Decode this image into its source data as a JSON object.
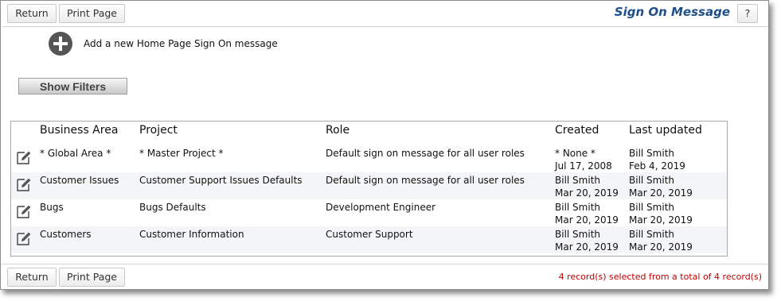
{
  "toolbar": {
    "return_label": "Return",
    "print_label": "Print Page",
    "help_label": "?"
  },
  "page_title": "Sign On Message",
  "add": {
    "icon": "plus-circle-icon",
    "label": "Add a new Home Page Sign On message"
  },
  "filters_label": "Show Filters",
  "table": {
    "headers": {
      "area": "Business Area",
      "project": "Project",
      "role": "Role",
      "created": "Created",
      "updated": "Last updated"
    },
    "rows": [
      {
        "area": "* Global Area *",
        "project": "* Master Project *",
        "role": "Default sign on message for all user roles",
        "created_by": "* None *",
        "created_on": "Jul 17, 2008",
        "updated_by": "Bill Smith",
        "updated_on": "Feb 4, 2019"
      },
      {
        "area": "Customer Issues",
        "project": "Customer Support Issues Defaults",
        "role": "Default sign on message for all user roles",
        "created_by": "Bill Smith",
        "created_on": "Mar 20, 2019",
        "updated_by": "Bill Smith",
        "updated_on": "Mar 20, 2019"
      },
      {
        "area": "Bugs",
        "project": "Bugs Defaults",
        "role": "Development Engineer",
        "created_by": "Bill Smith",
        "created_on": "Mar 20, 2019",
        "updated_by": "Bill Smith",
        "updated_on": "Mar 20, 2019"
      },
      {
        "area": "Customers",
        "project": "Customer Information",
        "role": "Customer Support",
        "created_by": "Bill Smith",
        "created_on": "Mar 20, 2019",
        "updated_by": "Bill Smith",
        "updated_on": "Mar 20, 2019"
      }
    ]
  },
  "footer": {
    "return_label": "Return",
    "print_label": "Print Page",
    "status": "4 record(s) selected from a total of 4 record(s)"
  },
  "colors": {
    "title": "#1f4f8a",
    "status": "#c00000",
    "row_alt": "#f4f5f7"
  }
}
